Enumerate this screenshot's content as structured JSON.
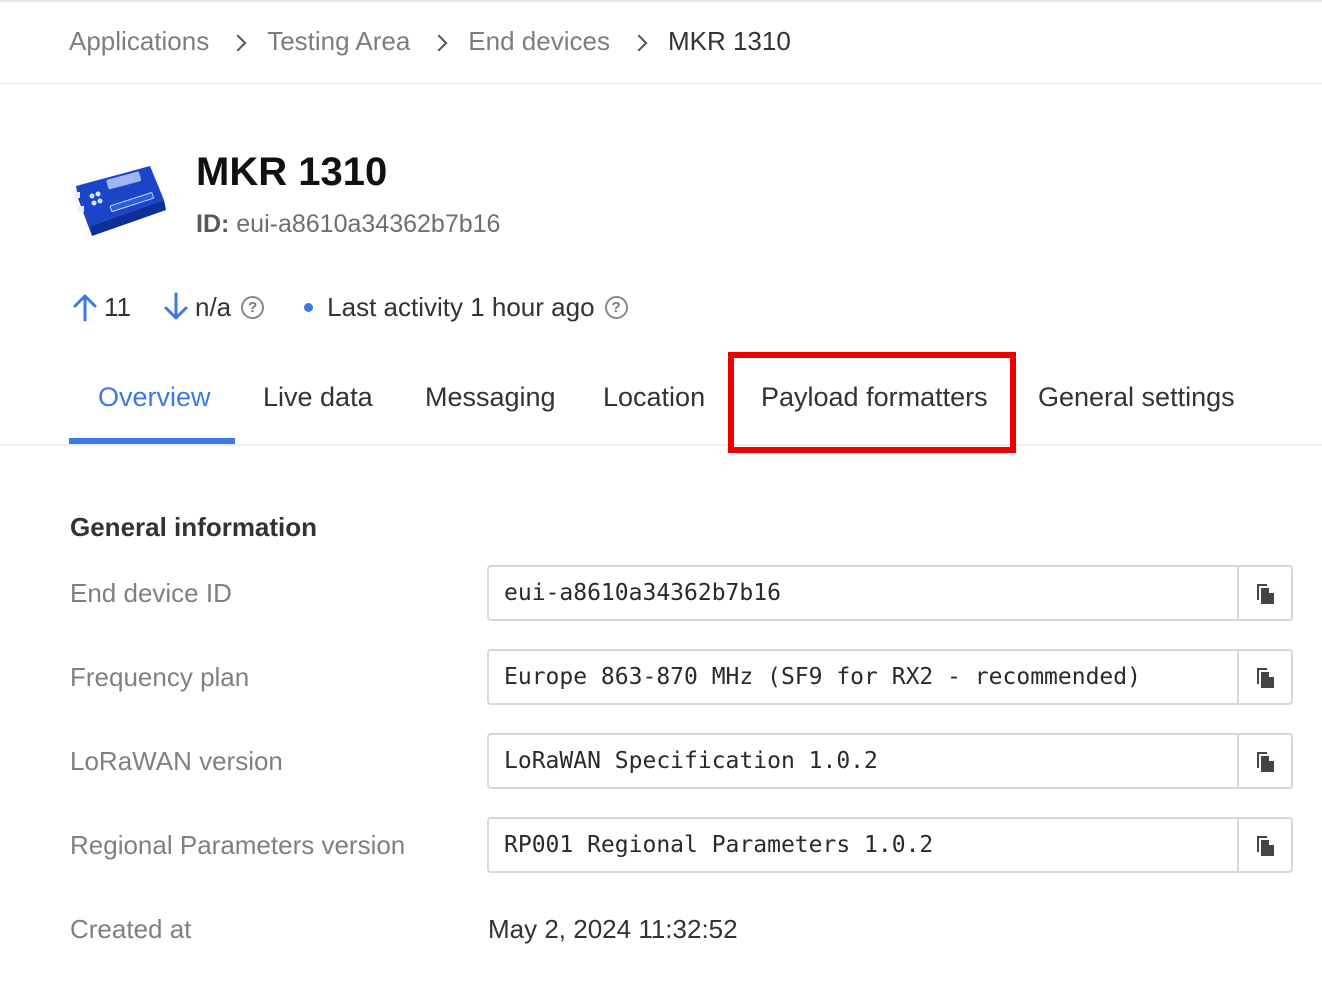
{
  "breadcrumb": {
    "items": [
      "Applications",
      "Testing Area",
      "End devices"
    ],
    "current": "MKR 1310"
  },
  "device": {
    "icon": "lorawan-board-icon",
    "name": "MKR 1310",
    "id_label": "ID:",
    "id_value": "eui-a8610a34362b7b16"
  },
  "stats": {
    "uplink_count": "11",
    "downlink_count": "n/a",
    "activity": "Last activity 1 hour ago"
  },
  "tabs": {
    "overview": "Overview",
    "live_data": "Live data",
    "messaging": "Messaging",
    "location": "Location",
    "payload_formatters": "Payload formatters",
    "general_settings": "General settings",
    "active": "Overview"
  },
  "general": {
    "title": "General information",
    "end_device_id_label": "End device ID",
    "end_device_id_value": "eui-a8610a34362b7b16",
    "frequency_plan_label": "Frequency plan",
    "frequency_plan_value": "Europe 863-870 MHz (SF9 for RX2 - recommended)",
    "lorawan_version_label": "LoRaWAN version",
    "lorawan_version_value": "LoRaWAN Specification 1.0.2",
    "regional_params_label": "Regional Parameters version",
    "regional_params_value": "RP001 Regional Parameters 1.0.2",
    "created_at_label": "Created at",
    "created_at_value": "May 2, 2024 11:32:52"
  },
  "colors": {
    "accent": "#3b7ae6",
    "highlight": "#ee0000"
  }
}
